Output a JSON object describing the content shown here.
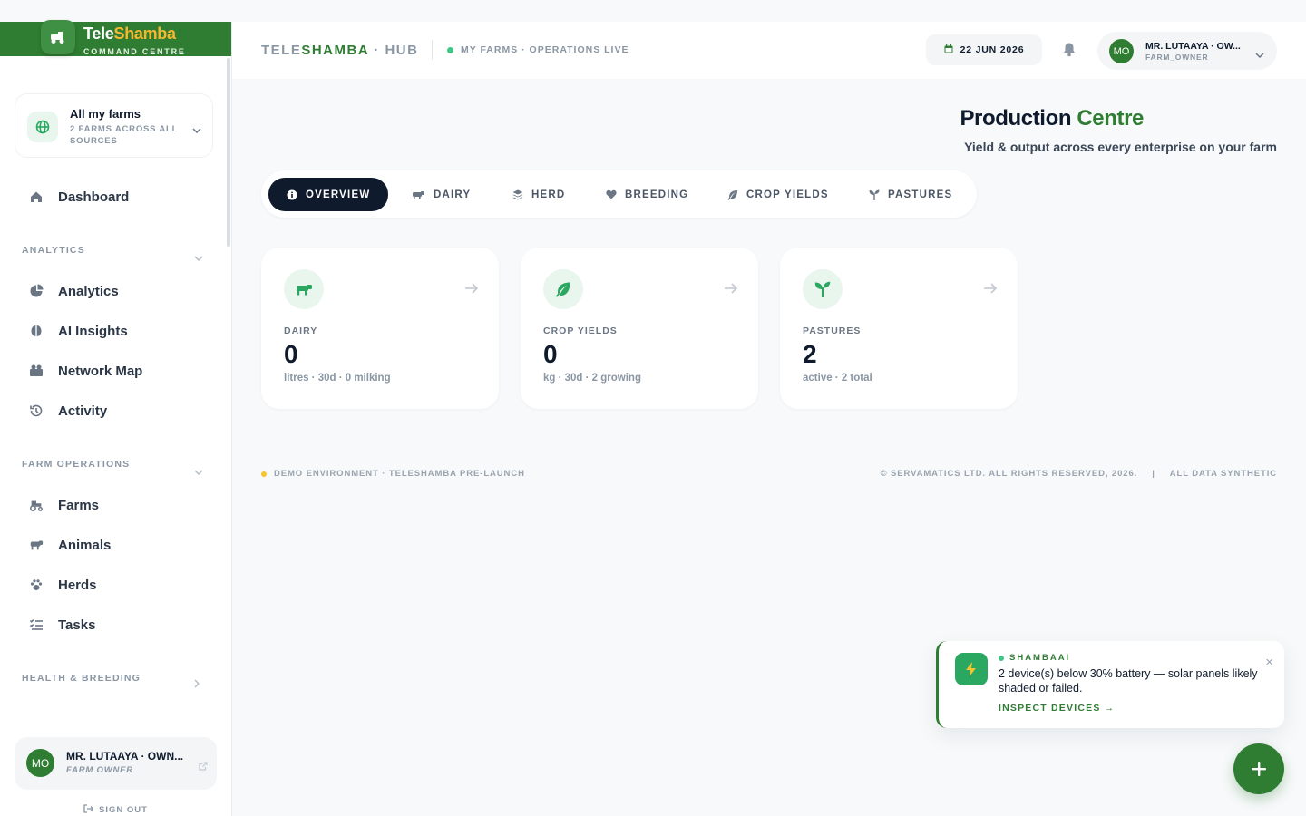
{
  "brand": {
    "name_part1": "Tele",
    "name_part2": "Shamba",
    "subtitle": "COMMAND CENTRE"
  },
  "farm_selector": {
    "title": "All my farms",
    "subtitle": "2 FARMS ACROSS ALL SOURCES",
    "icon": "globe-icon"
  },
  "sidebar": {
    "dashboard": "Dashboard",
    "sections": [
      {
        "label": "ANALYTICS",
        "expanded": true,
        "items": [
          "Analytics",
          "AI Insights",
          "Network Map",
          "Activity"
        ]
      },
      {
        "label": "FARM OPERATIONS",
        "expanded": true,
        "items": [
          "Farms",
          "Animals",
          "Herds",
          "Tasks"
        ]
      },
      {
        "label": "HEALTH & BREEDING",
        "expanded": false,
        "items": []
      }
    ],
    "user": {
      "initials": "MO",
      "name": "MR. LUTAAYA · OWN...",
      "role": "FARM OWNER"
    },
    "signout": "SIGN OUT"
  },
  "topbar": {
    "hub_part1": "TELE",
    "hub_part2": "SHAMBA",
    "hub_part3": " · HUB",
    "live_status": "MY FARMS · OPERATIONS LIVE",
    "date": "22 JUN 2026",
    "account": {
      "initials": "MO",
      "name": "MR. LUTAAYA · OW...",
      "role": "FARM_OWNER"
    }
  },
  "page": {
    "title_part1": "Production ",
    "title_part2": "Centre",
    "subtitle": "Yield & output across every enterprise on your farm"
  },
  "tabs": [
    {
      "label": "OVERVIEW",
      "icon": "info-icon",
      "active": true
    },
    {
      "label": "DAIRY",
      "icon": "cow-icon",
      "active": false
    },
    {
      "label": "HERD",
      "icon": "layers-icon",
      "active": false
    },
    {
      "label": "BREEDING",
      "icon": "heart-icon",
      "active": false
    },
    {
      "label": "CROP YIELDS",
      "icon": "leaf-icon",
      "active": false
    },
    {
      "label": "PASTURES",
      "icon": "sprout-icon",
      "active": false
    }
  ],
  "cards": [
    {
      "label": "DAIRY",
      "value": "0",
      "note": "litres · 30d · 0 milking",
      "icon": "cow-icon"
    },
    {
      "label": "CROP YIELDS",
      "value": "0",
      "note": "kg · 30d · 2 growing",
      "icon": "leaf-icon"
    },
    {
      "label": "PASTURES",
      "value": "2",
      "note": "active · 2 total",
      "icon": "sprout-icon"
    }
  ],
  "footer": {
    "left": "DEMO ENVIRONMENT · TELESHAMBA PRE-LAUNCH",
    "copyright": "© SERVAMATICS LTD. ALL RIGHTS RESERVED, 2026.",
    "separator": "|",
    "synthetic": "ALL DATA SYNTHETIC"
  },
  "toast": {
    "source": "SHAMBAAI",
    "message": "2 device(s) below 30% battery — solar panels likely shaded or failed.",
    "link": "INSPECT DEVICES →",
    "close": "×",
    "icon": "bolt-icon"
  },
  "fab": {
    "label": "+"
  },
  "colors": {
    "brand_green": "#2f7d32",
    "accent_yellow": "#f5b82e",
    "dark_navy": "#0f1b2d",
    "live_green": "#3ec785",
    "demo_yellow": "#f5c431"
  }
}
